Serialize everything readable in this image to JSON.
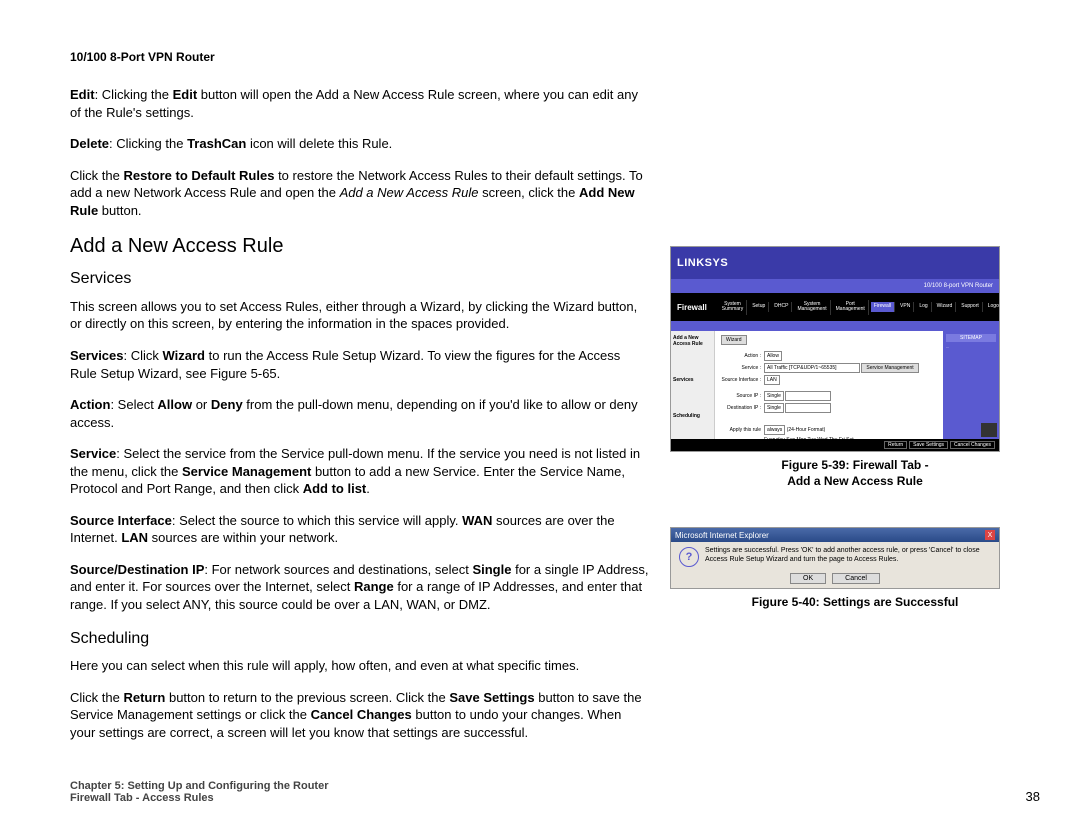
{
  "header": "10/100 8-Port VPN Router",
  "body": {
    "p1_pre": "Edit",
    "p1_mid": ": Clicking the ",
    "p1_btn": "Edit",
    "p1_post": " button will open the Add a New Access Rule screen, where you can edit any of the Rule's settings.",
    "p2_pre": "Delete",
    "p2_mid": ": Clicking the ",
    "p2_btn": "TrashCan",
    "p2_post": " icon will delete this Rule.",
    "p3_a": "Click the ",
    "p3_b": "Restore to Default Rules",
    "p3_c": " to restore the Network Access Rules to their default settings. To add a new Network Access Rule and open the ",
    "p3_d": "Add a New Access Rule",
    "p3_e": " screen, click the ",
    "p3_f": "Add New Rule",
    "p3_g": " button.",
    "h_add": "Add a New Access Rule",
    "h_services": "Services",
    "p4": "This screen allows you to set Access Rules, either through a Wizard, by clicking the Wizard button, or directly on this screen, by entering the information in the spaces provided.",
    "p5_a": "Services",
    "p5_b": ": Click ",
    "p5_c": "Wizard",
    "p5_d": " to run the Access Rule Setup Wizard. To view the figures for the Access Rule Setup Wizard, see Figure 5-65.",
    "p6_a": "Action",
    "p6_b": ": Select ",
    "p6_c": "Allow",
    "p6_d": " or ",
    "p6_e": "Deny",
    "p6_f": " from the pull-down menu, depending on if you'd like to allow or deny access.",
    "p7_a": "Service",
    "p7_b": ": Select the service from the Service pull-down menu. If the service you need is not listed in the menu, click the ",
    "p7_c": "Service Management",
    "p7_d": " button to add a new Service. Enter the Service Name, Protocol and Port Range, and then click ",
    "p7_e": "Add to list",
    "p7_f": ".",
    "p8_a": "Source Interface",
    "p8_b": ": Select the source to which this service will apply. ",
    "p8_c": "WAN",
    "p8_d": " sources are over the Internet. ",
    "p8_e": "LAN",
    "p8_f": " sources are within your network.",
    "p9_a": "Source/Destination IP",
    "p9_b": ": For network sources and destinations, select ",
    "p9_c": "Single",
    "p9_d": " for a single IP Address, and enter it. For sources over the Internet, select ",
    "p9_e": "Range",
    "p9_f": " for a range of IP Addresses, and enter that range. If you select ANY, this source could be over a LAN, WAN, or DMZ.",
    "h_scheduling": "Scheduling",
    "p10": "Here you can select when this rule will apply, how often, and even at what specific times.",
    "p11_a": "Click the ",
    "p11_b": "Return",
    "p11_c": " button to return to the previous screen. Click the ",
    "p11_d": "Save Settings",
    "p11_e": " button to save the Service Management settings or click the ",
    "p11_f": "Cancel Changes",
    "p11_g": " button to undo your changes. When your settings are correct, a screen will let you know that settings are successful."
  },
  "figures": {
    "fig1_line1": "Figure 5-39: Firewall Tab -",
    "fig1_line2": "Add a New Access Rule",
    "fig2": "Figure 5-40: Settings are Successful"
  },
  "shot1": {
    "brand": "LINKSYS",
    "product": "10/100 8-port VPN Router",
    "section": "Firewall",
    "tabs": [
      "System Summary",
      "Setup",
      "DHCP",
      "System Management",
      "Port Management",
      "Firewall",
      "VPN",
      "Log",
      "Wizard",
      "Support",
      "Logout"
    ],
    "sidelabels": [
      "Add a New Access Rule",
      "Services",
      "Scheduling"
    ],
    "wizard_btn": "Wizard",
    "form": {
      "action_lbl": "Action :",
      "action_val": "Allow",
      "service_lbl": "Service :",
      "service_val": "All Traffic [TCP&UDP/1~65535]",
      "svcmgmt": "Service Management",
      "srcif_lbl": "Source Interface :",
      "srcif_val": "LAN",
      "srcip_lbl": "Source IP :",
      "srcip_val": "Single",
      "dstip_lbl": "Destination IP :",
      "dstip_val": "Single",
      "apply_lbl": "Apply this rule",
      "apply_val": "always",
      "timefmt": "(24-Hour Format)",
      "days": "Everyday   Sun   Mon   Tue   Wed   Thu   Fri   Sat"
    },
    "sidebox_title": "SITEMAP",
    "bottom": [
      "Return",
      "Save Settings",
      "Cancel Changes"
    ]
  },
  "shot2": {
    "title": "Microsoft Internet Explorer",
    "close": "X",
    "msg": "Settings are successful. Press 'OK' to add another access rule, or press 'Cancel' to close Access Rule Setup Wizard and turn the page to Access Rules.",
    "ok": "OK",
    "cancel": "Cancel"
  },
  "footer": {
    "line1": "Chapter 5: Setting Up and Configuring the Router",
    "line2": "Firewall Tab - Access Rules",
    "page": "38"
  }
}
